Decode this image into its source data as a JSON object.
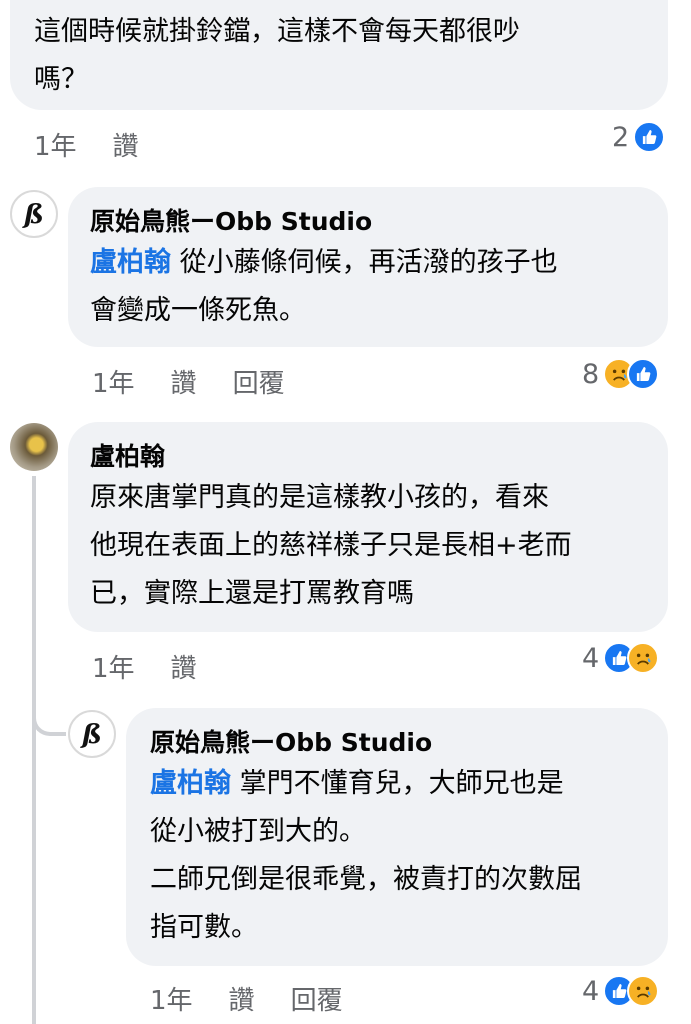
{
  "comments": [
    {
      "text": "這個時候就掛鈴鐺，這樣不會每天都很吵嗎？",
      "line1": "這個時候就掛鈴鐺，這樣不會每天都很吵",
      "line2": "嗎？",
      "time": "1年",
      "like": "讚",
      "count": "2",
      "reactions": [
        "like"
      ]
    },
    {
      "author": "原始鳥熊ーObb Studio",
      "mention": "盧柏翰",
      "line1": "從小藤條伺候，再活潑的孩子也",
      "line2": "會變成一條死魚。",
      "time": "1年",
      "like": "讚",
      "reply": "回覆",
      "count": "8",
      "reactions": [
        "sad",
        "like"
      ]
    },
    {
      "author": "盧柏翰",
      "line1": "原來唐掌門真的是這樣教小孩的，看來",
      "line2": "他現在表面上的慈祥樣子只是長相+老而",
      "line3": "已，實際上還是打罵教育嗎",
      "time": "1年",
      "like": "讚",
      "count": "4",
      "reactions": [
        "like",
        "sad"
      ]
    },
    {
      "author": "原始鳥熊ーObb Studio",
      "mention": "盧柏翰",
      "line1": "掌門不懂育兒，大師兄也是",
      "line2": "從小被打到大的。",
      "line3": "二師兄倒是很乖覺，被責打的次數屈",
      "line4": "指可數。",
      "time": "1年",
      "like": "讚",
      "reply": "回覆",
      "count": "4",
      "reactions": [
        "like",
        "sad"
      ]
    }
  ],
  "colors": {
    "bubble": "#f0f2f5",
    "mention": "#1b74e4",
    "like": "#1877f2",
    "sad": "#f7b125",
    "meta": "#65676b"
  },
  "icons": [
    "obb-studio-logo-avatar",
    "user-avatar",
    "like-reaction-icon",
    "sad-reaction-icon"
  ]
}
